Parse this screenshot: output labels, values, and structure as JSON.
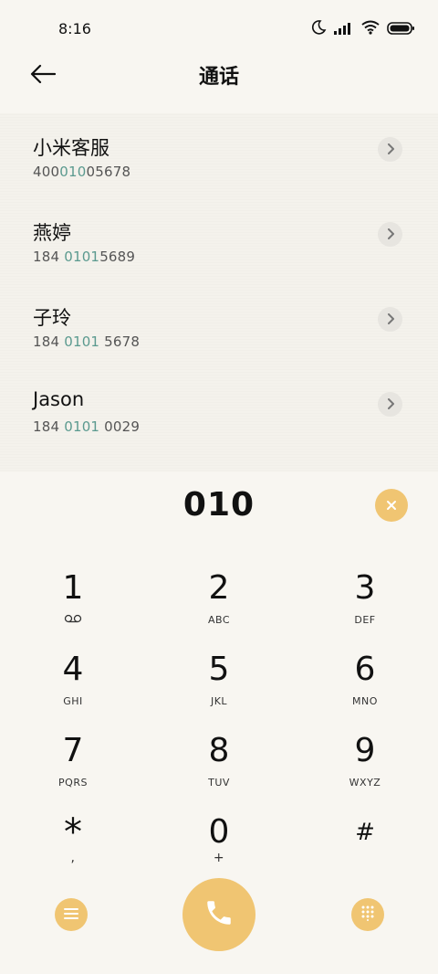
{
  "status_bar": {
    "time": "8:16",
    "icons": [
      "moon-icon",
      "signal-icon",
      "wifi-icon",
      "battery-icon"
    ]
  },
  "header": {
    "title": "通话",
    "back_icon": "back-arrow-icon"
  },
  "contacts": [
    {
      "name": "小米客服",
      "number_parts": [
        "400",
        "010",
        "05678"
      ]
    },
    {
      "name": "燕婷",
      "number_parts": [
        "184 ",
        "0101",
        "5689"
      ]
    },
    {
      "name": "子玲",
      "number_parts": [
        "184 ",
        "0101",
        " 5678"
      ]
    },
    {
      "name": "Jason",
      "number_parts": [
        "184 ",
        "0101",
        " 0029"
      ]
    }
  ],
  "dial": {
    "number": "010"
  },
  "keypad": [
    {
      "digit": "1",
      "letters": "",
      "icon": "voicemail-icon"
    },
    {
      "digit": "2",
      "letters": "ABC"
    },
    {
      "digit": "3",
      "letters": "DEF"
    },
    {
      "digit": "4",
      "letters": "GHI"
    },
    {
      "digit": "5",
      "letters": "JKL"
    },
    {
      "digit": "6",
      "letters": "MNO"
    },
    {
      "digit": "7",
      "letters": "PQRS"
    },
    {
      "digit": "8",
      "letters": "TUV"
    },
    {
      "digit": "9",
      "letters": "WXYZ"
    },
    {
      "digit": "*",
      "letters": ","
    },
    {
      "digit": "0",
      "letters": "+"
    },
    {
      "digit": "#",
      "letters": ""
    }
  ],
  "colors": {
    "accent": "#f0c572",
    "highlight": "#5b9a8f",
    "background": "#f8f6f1"
  }
}
